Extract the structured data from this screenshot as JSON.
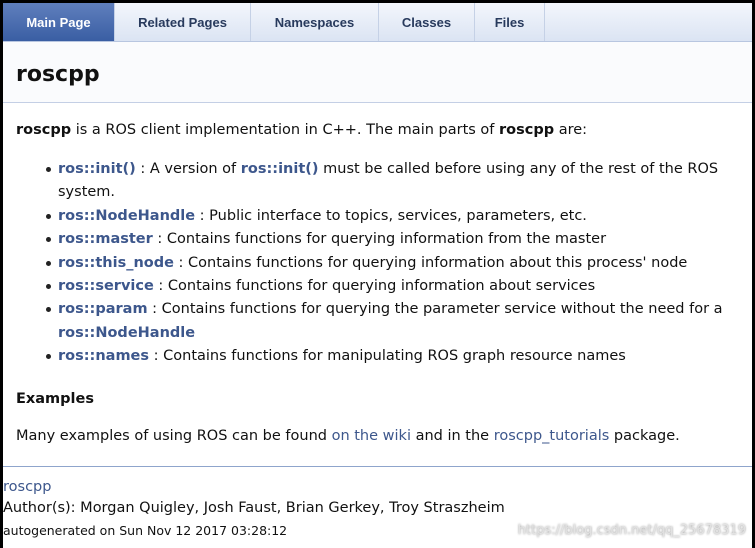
{
  "tabs": [
    "Main Page",
    "Related Pages",
    "Namespaces",
    "Classes",
    "Files"
  ],
  "active_tab": "Main Page",
  "page_title": "roscpp",
  "intro": {
    "lead": "roscpp",
    "text1": " is a ROS client implementation in C++. The main parts of ",
    "bold2": "roscpp",
    "text2": " are:"
  },
  "items": [
    {
      "link": "ros::init()",
      "text": " : A version of ",
      "link2": "ros::init()",
      "text2": " must be called before using any of the rest of the ROS system."
    },
    {
      "link": "ros::NodeHandle",
      "text": " : Public interface to topics, services, parameters, etc."
    },
    {
      "link": "ros::master",
      "text": " : Contains functions for querying information from the master"
    },
    {
      "link": "ros::this_node",
      "text": " : Contains functions for querying information about this process' node"
    },
    {
      "link": "ros::service",
      "text": " : Contains functions for querying information about services"
    },
    {
      "link": "ros::param",
      "text": " : Contains functions for querying the parameter service without the need for a ",
      "link2": "ros::NodeHandle"
    },
    {
      "link": "ros::names",
      "text": " : Contains functions for manipulating ROS graph resource names"
    }
  ],
  "examples": {
    "heading": "Examples",
    "text1": "Many examples of using ROS can be found ",
    "link1": "on the wiki",
    "text2": " and in the ",
    "link2": "roscpp_tutorials",
    "text3": " package."
  },
  "footer": {
    "package": "roscpp",
    "authors": "Author(s): Morgan Quigley, Josh Faust, Brian Gerkey, Troy Straszheim",
    "generated": "autogenerated on Sun Nov 12 2017 03:28:12"
  },
  "watermark": "https://blog.csdn.net/qq_25678319",
  "colors": {
    "link": "#3d578c",
    "active_tab": "#4665a2",
    "tab_bar": "#dbe4f3"
  }
}
